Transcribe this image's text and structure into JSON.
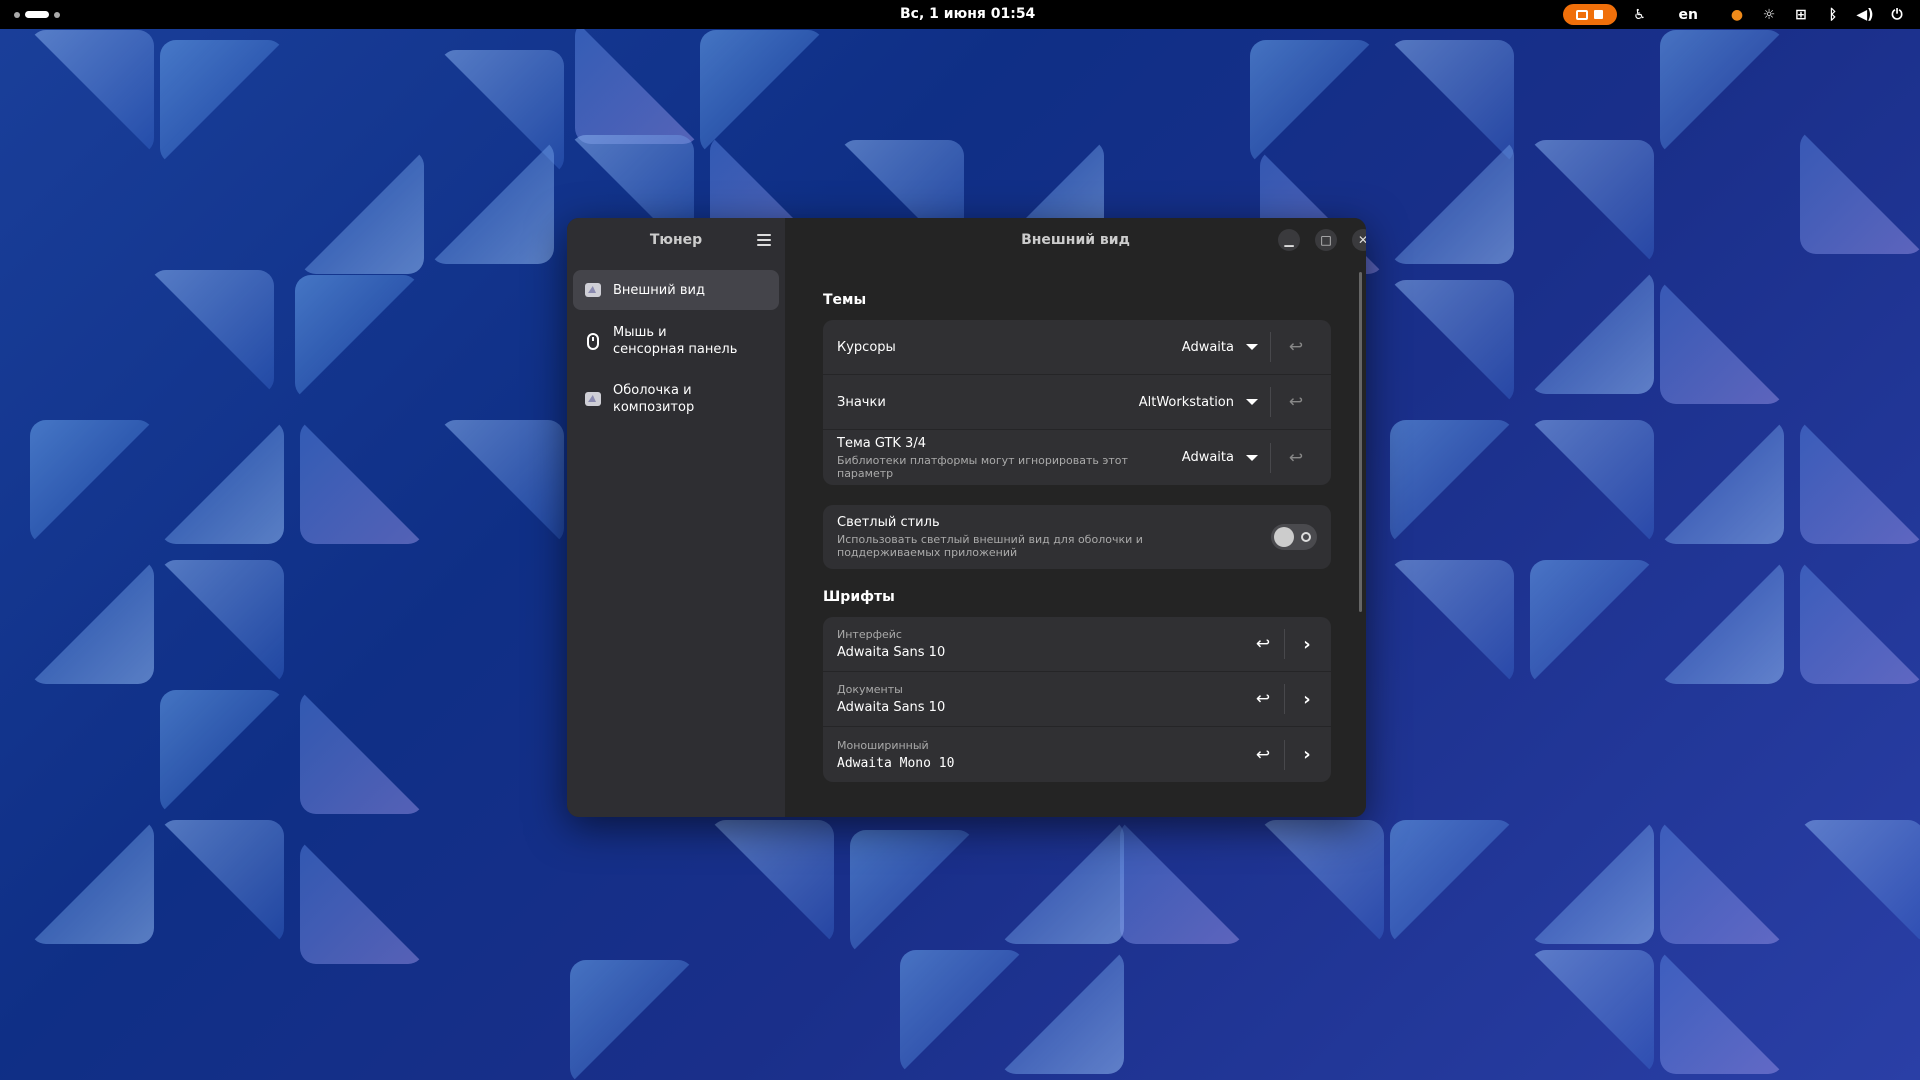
{
  "topbar": {
    "clock": "Вс, 1 июня  01:54",
    "lang": "en"
  },
  "window": {
    "sidebar_title": "Тюнер",
    "title": "Внешний вид",
    "nav": [
      {
        "label": "Внешний вид",
        "icon": "appearance-icon",
        "active": true
      },
      {
        "label": "Мышь и\nсенсорная панель",
        "icon": "mouse-icon",
        "active": false
      },
      {
        "label": "Оболочка и\nкомпозитор",
        "icon": "shell-icon",
        "active": false
      }
    ],
    "themes": {
      "title": "Темы",
      "cursors_label": "Курсоры",
      "cursors_value": "Adwaita",
      "icons_label": "Значки",
      "icons_value": "AltWorkstation",
      "gtk_label": "Тема GTK 3/4",
      "gtk_sub": "Библиотеки платформы могут игнорировать этот параметр",
      "gtk_value": "Adwaita"
    },
    "light": {
      "label": "Светлый стиль",
      "sub": "Использовать светлый внешний вид для оболочки и поддерживаемых приложений",
      "enabled": false
    },
    "fonts": {
      "title": "Шрифты",
      "interface_caption": "Интерфейс",
      "interface_value": "Adwaita Sans 10",
      "documents_caption": "Документы",
      "documents_value": "Adwaita Sans 10",
      "mono_caption": "Моноширинный",
      "mono_value": "Adwaita Mono 10"
    }
  },
  "colors": {
    "accent_recording": "#f06f0a",
    "window_bg": "#242424",
    "sidebar_bg": "#2e2e32"
  }
}
